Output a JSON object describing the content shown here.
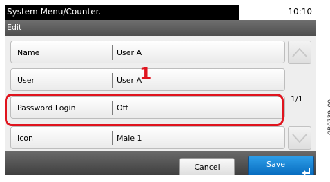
{
  "header": {
    "title": "System Menu/Counter.",
    "time": "10:10",
    "subtitle": "Edit"
  },
  "rows": [
    {
      "label": "Name",
      "value": "User A"
    },
    {
      "label": "User",
      "value": "User A"
    },
    {
      "label": "Password Login",
      "value": "Off"
    },
    {
      "label": "Icon",
      "value": "Male 1"
    }
  ],
  "pagination": {
    "indicator": "1/1"
  },
  "footer": {
    "cancel_label": "Cancel",
    "save_label": "Save"
  },
  "annotation": {
    "callout_number": "1",
    "doc_id": "GB0739_00"
  },
  "colors": {
    "highlight": "#e0141e",
    "save_button": "#0a7fd6"
  }
}
